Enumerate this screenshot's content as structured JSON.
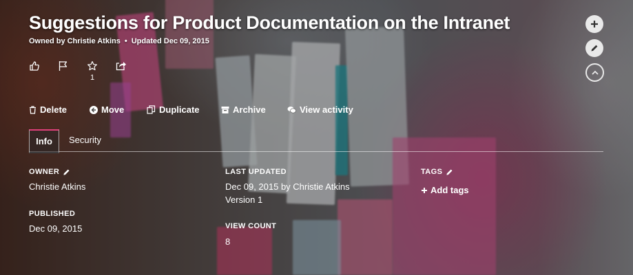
{
  "header": {
    "title": "Suggestions for Product Documentation on the Intranet",
    "owned_by": "Owned by Christie Atkins",
    "separator": "•",
    "updated": "Updated Dec 09, 2015"
  },
  "reactions": {
    "like_icon": "thumbs-up-icon",
    "flag_icon": "flag-icon",
    "flag_count": "1",
    "favorite_icon": "star-icon",
    "share_icon": "share-icon"
  },
  "side_buttons": [
    "plus-icon",
    "pencil-icon",
    "chevron-up-icon"
  ],
  "actions": {
    "delete": "Delete",
    "move": "Move",
    "duplicate": "Duplicate",
    "archive": "Archive",
    "view_activity": "View activity"
  },
  "tabs": [
    {
      "label": "Info",
      "active": true
    },
    {
      "label": "Security",
      "active": false
    }
  ],
  "info": {
    "owner_label": "OWNER",
    "owner_value": "Christie Atkins",
    "published_label": "PUBLISHED",
    "published_value": "Dec 09, 2015",
    "last_updated_label": "LAST UPDATED",
    "last_updated_value": "Dec 09, 2015 by Christie Atkins",
    "version": "Version 1",
    "view_count_label": "VIEW COUNT",
    "view_count_value": "8",
    "tags_label": "TAGS",
    "add_tags": "Add tags"
  },
  "colors": {
    "accent": "#e0407a",
    "button_bg": "#e9e9e9"
  }
}
